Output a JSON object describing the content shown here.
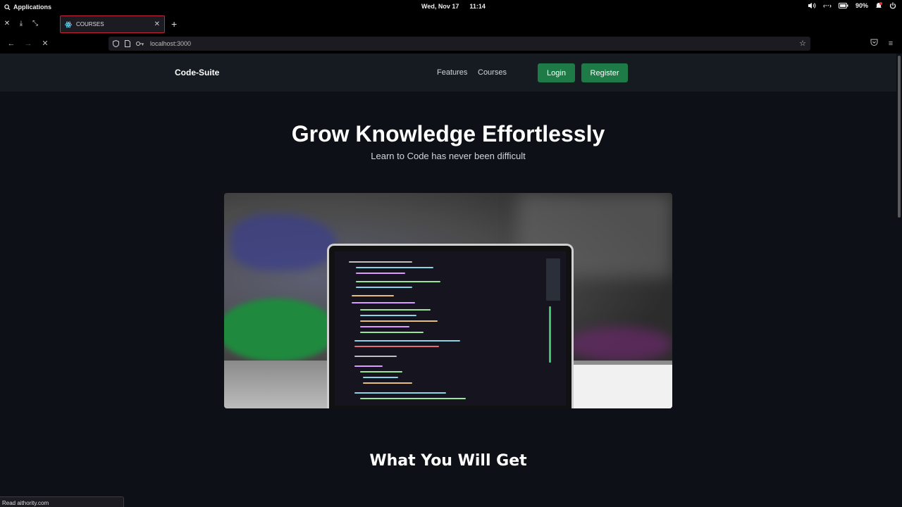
{
  "os": {
    "app_menu": "Applications",
    "date": "Wed, Nov 17",
    "time": "11:14",
    "battery": "90%"
  },
  "browser": {
    "tab_title": "COURSES",
    "url": "localhost:3000",
    "status_text": "Read aithority.com"
  },
  "site": {
    "brand": "Code-Suite",
    "nav": {
      "features": "Features",
      "courses": "Courses"
    },
    "login": "Login",
    "register": "Register",
    "hero_title": "Grow Knowledge Effortlessly",
    "hero_subtitle": "Learn to Code has never been difficult",
    "section_title": "What You Will Get"
  }
}
